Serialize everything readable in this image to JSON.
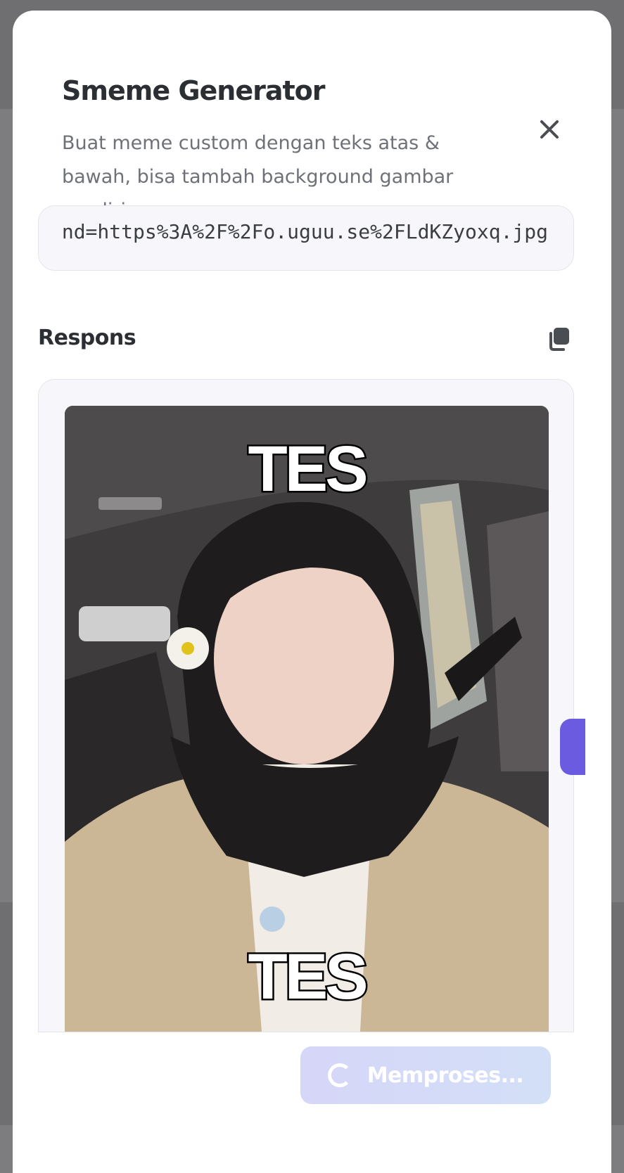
{
  "modal": {
    "title": "Smeme Generator",
    "description": "Buat meme custom dengan teks atas & bawah, bisa tambah background gambar sendiri."
  },
  "url_field": {
    "value": "nd=https%3A%2F%2Fo.uguu.se%2FLdKZyoxq.jpg"
  },
  "response": {
    "label": "Respons",
    "meme_top_text": "TES",
    "meme_bottom_text": "TES"
  },
  "submit": {
    "label": "Memproses..."
  },
  "icons": {
    "close": "close-icon",
    "copy": "copy-icon",
    "spinner": "spinner-icon"
  },
  "colors": {
    "accent": "#6b5be0",
    "button_bg": "#d6d6f8",
    "title": "#2b2f33"
  }
}
